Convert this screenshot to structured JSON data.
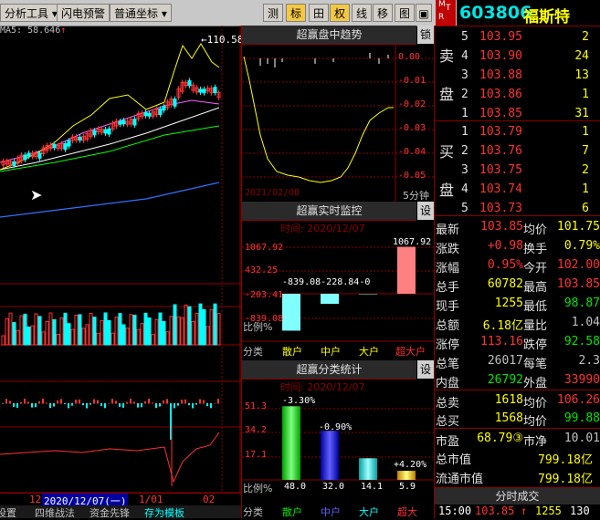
{
  "toolbar": {
    "items": [
      "分析工具",
      "闪电预警",
      "普通坐标"
    ],
    "icons_right": [
      "测",
      "标",
      "田",
      "权",
      "线",
      "移",
      "图"
    ]
  },
  "stock": {
    "code": "603806",
    "name": "福斯特",
    "badge_top": "M",
    "badge_left": "T",
    "badge_right": "R"
  },
  "chart": {
    "ma_label": "MA5: 58.646",
    "ma_arrow": "↑",
    "high_label": "110.58",
    "date_label": "2020/12/07(一)",
    "x_ticks": [
      "12",
      "1/01",
      "02"
    ],
    "left_num": "12"
  },
  "trend": {
    "title": "超赢盘中趋势",
    "lock": "锁",
    "y_labels": [
      "0.00",
      "-0.01",
      "-0.02",
      "-0.03",
      "-0.04",
      "-0.05"
    ],
    "date": "2021/02/08",
    "period": "5分钟"
  },
  "monitor": {
    "title": "超赢实时监控",
    "set": "设",
    "time": "时间: 2020/12/07",
    "y_labels": [
      "1067.92",
      "432.25",
      "-203.41",
      "-839.08"
    ],
    "bar_labels": [
      "-839.08",
      "-228.84",
      "-0",
      "1067.92"
    ],
    "ratio_label": "比例%",
    "cat_label": "分类",
    "categories": [
      "散户",
      "中户",
      "大户",
      "超大户"
    ]
  },
  "stats_panel": {
    "title": "超赢分类统计",
    "set": "设",
    "time": "时间: 2020/12/07",
    "y_labels": [
      "51.3",
      "34.2",
      "17.1"
    ],
    "pct_labels": [
      "-3.30%",
      "-0.90%",
      "+4.20%"
    ],
    "ratio_label": "比例%",
    "ratios": [
      "48.0",
      "32.0",
      "14.1",
      "5.9"
    ],
    "cat_label": "分类",
    "categories": [
      "散户",
      "中户",
      "大户",
      "超大"
    ]
  },
  "bottom_tabs": [
    "设置",
    "四维战法",
    "资金先锋",
    "存为模板"
  ],
  "orderbook": {
    "sell_label": [
      "卖",
      "盘"
    ],
    "buy_label": [
      "买",
      "盘"
    ],
    "sells": [
      {
        "n": "5",
        "price": "103.95",
        "vol": "2"
      },
      {
        "n": "4",
        "price": "103.90",
        "vol": "24"
      },
      {
        "n": "3",
        "price": "103.88",
        "vol": "13"
      },
      {
        "n": "2",
        "price": "103.86",
        "vol": "1"
      },
      {
        "n": "1",
        "price": "103.85",
        "vol": "31"
      }
    ],
    "buys": [
      {
        "n": "1",
        "price": "103.79",
        "vol": "1"
      },
      {
        "n": "2",
        "price": "103.76",
        "vol": "7"
      },
      {
        "n": "3",
        "price": "103.75",
        "vol": "2"
      },
      {
        "n": "4",
        "price": "103.74",
        "vol": "1"
      },
      {
        "n": "5",
        "price": "103.73",
        "vol": "6"
      }
    ]
  },
  "quote": [
    {
      "l1": "最新",
      "v1": "103.85",
      "l2": "均价",
      "v2": "101.75"
    },
    {
      "l1": "涨跌",
      "v1": "+0.98",
      "l2": "换手",
      "v2": "0.79%"
    },
    {
      "l1": "涨幅",
      "v1": "0.95%",
      "l2": "今开",
      "v2": "102.00"
    },
    {
      "l1": "总手",
      "v1": "60782",
      "l2": "最高",
      "v2": "103.85"
    },
    {
      "l1": "现手",
      "v1": "1255",
      "l2": "最低",
      "v2": "98.87"
    },
    {
      "l1": "总额",
      "v1": "6.18亿",
      "l2": "量比",
      "v2": "1.04"
    },
    {
      "l1": "涨停",
      "v1": "113.16",
      "l2": "跌停",
      "v2": "92.58"
    },
    {
      "l1": "总笔",
      "v1": "26017",
      "l2": "每笔",
      "v2": "2.3"
    },
    {
      "l1": "内盘",
      "v1": "26792",
      "l2": "外盘",
      "v2": "33990"
    },
    {
      "l1": "总卖",
      "v1": "1618",
      "l2": "均价",
      "v2": "106.26"
    },
    {
      "l1": "总买",
      "v1": "1568",
      "l2": "均价",
      "v2": "99.88"
    },
    {
      "l1": "市盈",
      "v1": "68.79③",
      "l2": "市净",
      "v2": "10.01"
    },
    {
      "l1": "总市值",
      "v1": "799.18亿",
      "l2": "",
      "v2": ""
    },
    {
      "l1": "流通市值",
      "v1": "799.18亿",
      "l2": "",
      "v2": ""
    }
  ],
  "tick": {
    "header": "分时成交",
    "time": "15:00",
    "price": "103.85",
    "dir": "↑",
    "vol": "1255",
    "num": "130"
  },
  "colors": {
    "up": "#ff3232",
    "down": "#00ffff",
    "grid": "#8b0000",
    "accent": "#ffff00"
  }
}
